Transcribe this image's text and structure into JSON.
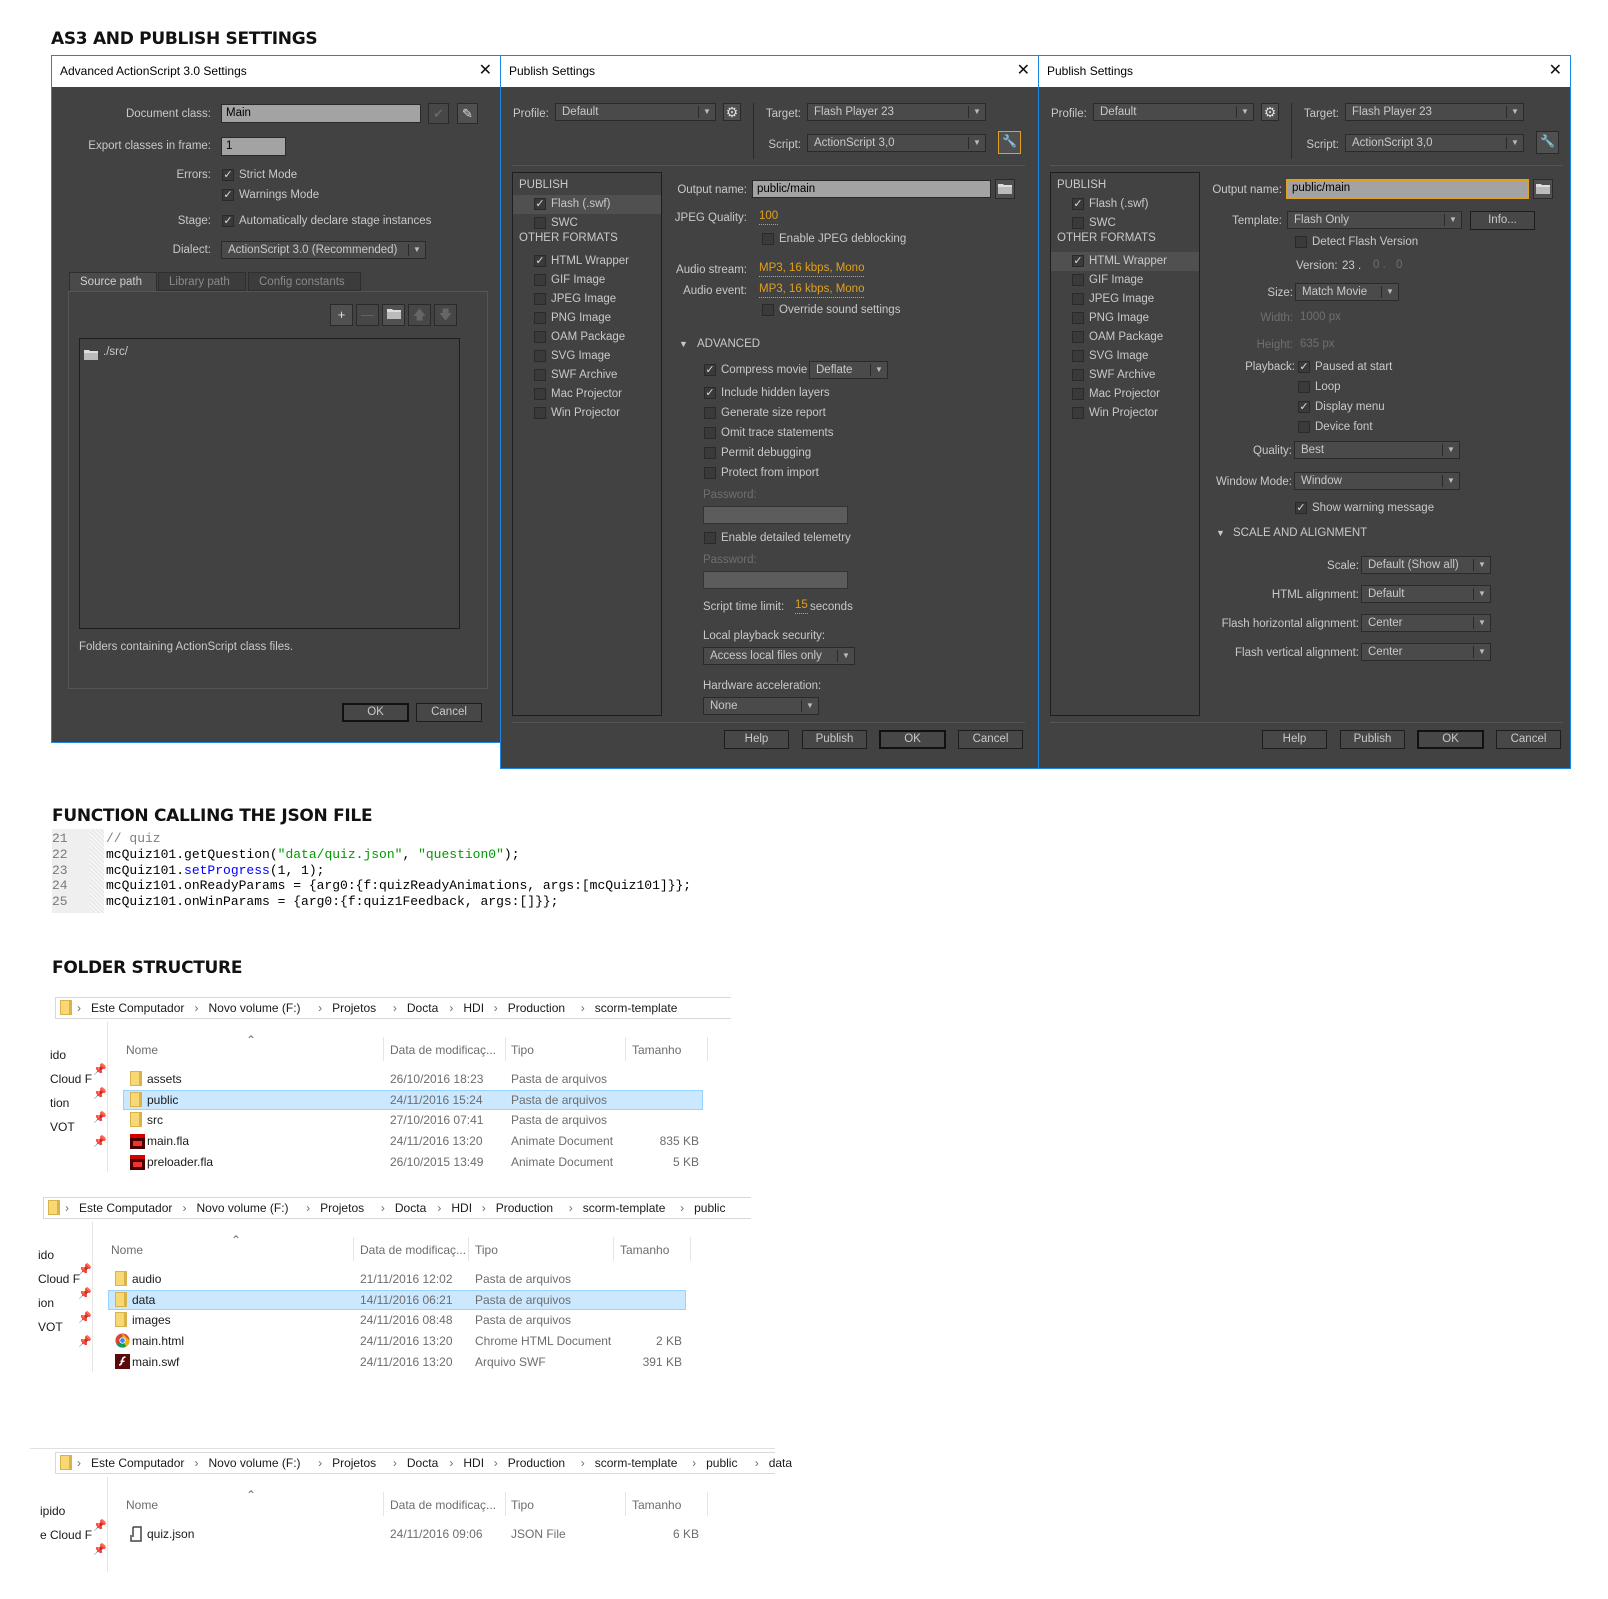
{
  "headings": {
    "as3": "AS3 AND PUBLISH SETTINGS",
    "function": "FUNCTION CALLING THE JSON FILE",
    "folder": "FOLDER STRUCTURE"
  },
  "colors": {
    "dialog_bg": "#424242",
    "dialog_border": "#1c86e0",
    "accent_orange": "#e0a020",
    "selection_blue": "#cce8ff",
    "code_comment": "#808080",
    "code_string": "#009900",
    "code_method": "#0000ff"
  },
  "as3_dialog": {
    "title": "Advanced ActionScript 3.0 Settings",
    "document_class": {
      "label": "Document class:",
      "value": "Main"
    },
    "export_frame": {
      "label": "Export classes in frame:",
      "value": "1"
    },
    "errors": {
      "label": "Errors:",
      "strict": {
        "label": "Strict Mode",
        "checked": true
      },
      "warnings": {
        "label": "Warnings Mode",
        "checked": true
      }
    },
    "stage": {
      "label": "Stage:",
      "auto_declare": {
        "label": "Automatically declare stage instances",
        "checked": true
      }
    },
    "dialect": {
      "label": "Dialect:",
      "value": "ActionScript 3.0 (Recommended)"
    },
    "tabs": [
      {
        "label": "Source path",
        "active": true
      },
      {
        "label": "Library path",
        "active": false
      },
      {
        "label": "Config constants",
        "active": false
      }
    ],
    "paths": [
      "./src/"
    ],
    "hint": "Folders containing ActionScript class files.",
    "ok": "OK",
    "cancel": "Cancel"
  },
  "publish_dialogs": [
    {
      "title": "Publish Settings",
      "profile": {
        "label": "Profile:",
        "value": "Default"
      },
      "target": {
        "label": "Target:",
        "value": "Flash Player 23"
      },
      "script": {
        "label": "Script:",
        "value": "ActionScript 3,0"
      },
      "publish_header": "PUBLISH",
      "other_header": "OTHER FORMATS",
      "publish_items": [
        {
          "label": "Flash (.swf)",
          "checked": true,
          "selected": true
        },
        {
          "label": "SWC",
          "checked": false,
          "selected": false
        }
      ],
      "other_items": [
        {
          "label": "HTML Wrapper",
          "checked": true,
          "selected": false
        },
        {
          "label": "GIF Image",
          "checked": false,
          "selected": false
        },
        {
          "label": "JPEG Image",
          "checked": false,
          "selected": false
        },
        {
          "label": "PNG Image",
          "checked": false,
          "selected": false
        },
        {
          "label": "OAM Package",
          "checked": false,
          "selected": false
        },
        {
          "label": "SVG Image",
          "checked": false,
          "selected": false
        },
        {
          "label": "SWF Archive",
          "checked": false,
          "selected": false
        },
        {
          "label": "Mac Projector",
          "checked": false,
          "selected": false
        },
        {
          "label": "Win Projector",
          "checked": false,
          "selected": false
        }
      ],
      "output": {
        "label": "Output name:",
        "value": "public/main"
      },
      "jpeg_quality": {
        "label": "JPEG Quality:",
        "value": "100"
      },
      "jpeg_deblocking": {
        "label": "Enable JPEG deblocking",
        "checked": false
      },
      "audio_stream": {
        "label": "Audio stream:",
        "value": "MP3, 16 kbps, Mono"
      },
      "audio_event": {
        "label": "Audio event:",
        "value": "MP3, 16 kbps, Mono"
      },
      "override_sound": {
        "label": "Override sound settings",
        "checked": false
      },
      "advanced_header": "ADVANCED",
      "compress": {
        "label": "Compress movie",
        "checked": true,
        "value": "Deflate"
      },
      "options": [
        {
          "label": "Include hidden layers",
          "checked": true
        },
        {
          "label": "Generate size report",
          "checked": false
        },
        {
          "label": "Omit trace statements",
          "checked": false
        },
        {
          "label": "Permit debugging",
          "checked": false
        },
        {
          "label": "Protect from import",
          "checked": false
        }
      ],
      "password_label": "Password:",
      "telemetry": {
        "label": "Enable detailed telemetry",
        "checked": false
      },
      "password2_label": "Password:",
      "script_time": {
        "label": "Script time limit:",
        "value": "15",
        "unit": "seconds"
      },
      "local_security": {
        "label": "Local playback security:",
        "value": "Access local files only"
      },
      "hw_accel": {
        "label": "Hardware acceleration:",
        "value": "None"
      },
      "buttons": {
        "help": "Help",
        "publish": "Publish",
        "ok": "OK",
        "cancel": "Cancel"
      }
    },
    {
      "title": "Publish Settings",
      "profile": {
        "label": "Profile:",
        "value": "Default"
      },
      "target": {
        "label": "Target:",
        "value": "Flash Player 23"
      },
      "script": {
        "label": "Script:",
        "value": "ActionScript 3,0"
      },
      "publish_header": "PUBLISH",
      "other_header": "OTHER FORMATS",
      "publish_items": [
        {
          "label": "Flash (.swf)",
          "checked": true,
          "selected": false
        },
        {
          "label": "SWC",
          "checked": false,
          "selected": false
        }
      ],
      "other_items": [
        {
          "label": "HTML Wrapper",
          "checked": true,
          "selected": true
        },
        {
          "label": "GIF Image",
          "checked": false,
          "selected": false
        },
        {
          "label": "JPEG Image",
          "checked": false,
          "selected": false
        },
        {
          "label": "PNG Image",
          "checked": false,
          "selected": false
        },
        {
          "label": "OAM Package",
          "checked": false,
          "selected": false
        },
        {
          "label": "SVG Image",
          "checked": false,
          "selected": false
        },
        {
          "label": "SWF Archive",
          "checked": false,
          "selected": false
        },
        {
          "label": "Mac Projector",
          "checked": false,
          "selected": false
        },
        {
          "label": "Win Projector",
          "checked": false,
          "selected": false
        }
      ],
      "output": {
        "label": "Output name:",
        "value": "public/main"
      },
      "template": {
        "label": "Template:",
        "value": "Flash Only",
        "info": "Info..."
      },
      "detect_version": {
        "label": "Detect Flash Version",
        "checked": false
      },
      "version": {
        "label": "Version:",
        "major": "23 .",
        "minor": "0 .",
        "rev": "0"
      },
      "size": {
        "label": "Size:",
        "value": "Match Movie"
      },
      "width": {
        "label": "Width:",
        "value": "1000 px"
      },
      "height": {
        "label": "Height:",
        "value": "635 px"
      },
      "playback": {
        "label": "Playback:",
        "options": [
          {
            "label": "Paused at start",
            "checked": true
          },
          {
            "label": "Loop",
            "checked": false
          },
          {
            "label": "Display menu",
            "checked": true
          },
          {
            "label": "Device font",
            "checked": false
          }
        ]
      },
      "quality": {
        "label": "Quality:",
        "value": "Best"
      },
      "window_mode": {
        "label": "Window Mode:",
        "value": "Window"
      },
      "show_warning": {
        "label": "Show warning message",
        "checked": true
      },
      "scale_header": "SCALE AND ALIGNMENT",
      "scale": {
        "label": "Scale:",
        "value": "Default (Show all)"
      },
      "html_align": {
        "label": "HTML alignment:",
        "value": "Default"
      },
      "flash_h_align": {
        "label": "Flash horizontal alignment:",
        "value": "Center"
      },
      "flash_v_align": {
        "label": "Flash vertical alignment:",
        "value": "Center"
      },
      "buttons": {
        "help": "Help",
        "publish": "Publish",
        "ok": "OK",
        "cancel": "Cancel"
      }
    }
  ],
  "code": {
    "lines": [
      {
        "num": "21",
        "tokens": [
          {
            "t": "// quiz",
            "k": "comment"
          }
        ]
      },
      {
        "num": "22",
        "tokens": [
          {
            "t": "mcQuiz101.getQuestion(",
            "k": "plain"
          },
          {
            "t": "\"data/quiz.json\"",
            "k": "string"
          },
          {
            "t": ", ",
            "k": "plain"
          },
          {
            "t": "\"question0\"",
            "k": "string"
          },
          {
            "t": ");",
            "k": "plain"
          }
        ]
      },
      {
        "num": "23",
        "tokens": [
          {
            "t": "mcQuiz101.",
            "k": "plain"
          },
          {
            "t": "setProgress",
            "k": "method"
          },
          {
            "t": "(1, 1);",
            "k": "plain"
          }
        ]
      },
      {
        "num": "24",
        "tokens": [
          {
            "t": "mcQuiz101.onReadyParams = {arg0:{f:quizReadyAnimations, args:[mcQuiz101]}};",
            "k": "plain"
          }
        ]
      },
      {
        "num": "25",
        "tokens": [
          {
            "t": "mcQuiz101.onWinParams = {arg0:{f:quiz1Feedback, args:[]}};",
            "k": "plain"
          }
        ]
      }
    ]
  },
  "explorers": [
    {
      "breadcrumb": [
        "Este Computador",
        "Novo volume (F:)",
        "Projetos",
        "Docta",
        "HDI",
        "Production",
        "scorm-template"
      ],
      "columns": [
        "Nome",
        "Data de modificaç...",
        "Tipo",
        "Tamanho"
      ],
      "nav": [
        "ido",
        "Cloud F",
        "tion",
        "VOT"
      ],
      "rows": [
        {
          "name": "assets",
          "icon": "folder",
          "date": "26/10/2016 18:23",
          "type": "Pasta de arquivos",
          "size": "",
          "selected": false
        },
        {
          "name": "public",
          "icon": "folder",
          "date": "24/11/2016 15:24",
          "type": "Pasta de arquivos",
          "size": "",
          "selected": true
        },
        {
          "name": "src",
          "icon": "folder",
          "date": "27/10/2016 07:41",
          "type": "Pasta de arquivos",
          "size": "",
          "selected": false
        },
        {
          "name": "main.fla",
          "icon": "animate",
          "date": "24/11/2016 13:20",
          "type": "Animate Document",
          "size": "835 KB",
          "selected": false
        },
        {
          "name": "preloader.fla",
          "icon": "animate",
          "date": "26/10/2015 13:49",
          "type": "Animate Document",
          "size": "5 KB",
          "selected": false
        }
      ]
    },
    {
      "breadcrumb": [
        "Este Computador",
        "Novo volume (F:)",
        "Projetos",
        "Docta",
        "HDI",
        "Production",
        "scorm-template",
        "public"
      ],
      "columns": [
        "Nome",
        "Data de modificaç...",
        "Tipo",
        "Tamanho"
      ],
      "nav": [
        "ido",
        "Cloud F",
        "ion",
        "VOT"
      ],
      "rows": [
        {
          "name": "audio",
          "icon": "folder",
          "date": "21/11/2016 12:02",
          "type": "Pasta de arquivos",
          "size": "",
          "selected": false
        },
        {
          "name": "data",
          "icon": "folder",
          "date": "14/11/2016 06:21",
          "type": "Pasta de arquivos",
          "size": "",
          "selected": true
        },
        {
          "name": "images",
          "icon": "folder",
          "date": "24/11/2016 08:48",
          "type": "Pasta de arquivos",
          "size": "",
          "selected": false
        },
        {
          "name": "main.html",
          "icon": "chrome",
          "date": "24/11/2016 13:20",
          "type": "Chrome HTML Document",
          "size": "2 KB",
          "selected": false
        },
        {
          "name": "main.swf",
          "icon": "flash",
          "date": "24/11/2016 13:20",
          "type": "Arquivo SWF",
          "size": "391 KB",
          "selected": false
        }
      ]
    },
    {
      "breadcrumb": [
        "Este Computador",
        "Novo volume (F:)",
        "Projetos",
        "Docta",
        "HDI",
        "Production",
        "scorm-template",
        "public",
        "data"
      ],
      "columns": [
        "Nome",
        "Data de modificaç...",
        "Tipo",
        "Tamanho"
      ],
      "nav": [
        "ipido",
        "e Cloud F"
      ],
      "rows": [
        {
          "name": "quiz.json",
          "icon": "json",
          "date": "24/11/2016 09:06",
          "type": "JSON File",
          "size": "6 KB",
          "selected": false
        }
      ]
    }
  ]
}
